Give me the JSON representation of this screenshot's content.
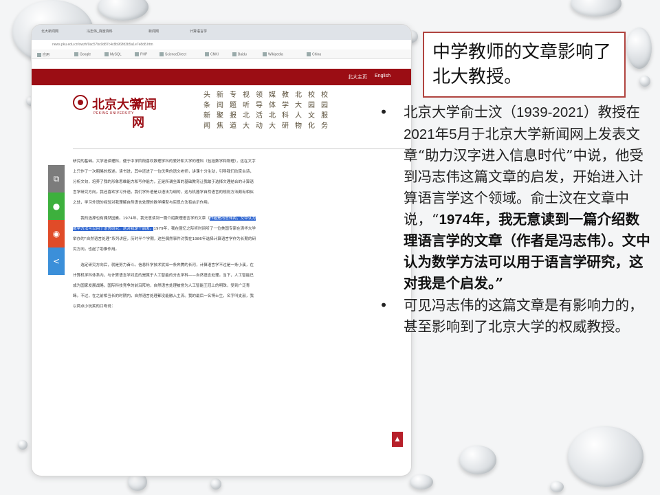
{
  "slide": {
    "title": "中学教师的文章影响了北大教授。",
    "bullets": [
      {
        "text_before": "北京大学俞士汶（",
        "years": "1939-2021",
        "text_mid": "）教授在",
        "month": "2021",
        "text_mid2": "年",
        "month_num": "5",
        "text_after": "月于北京大学新闻网上发表文章“助力汉字进入信息时代”中说，他受到冯志伟这篇文章的启发，开始进入计算语言学这个领域。俞士汶在文章中说，“",
        "quote_year": "1974",
        "quote": "年，我无意读到一篇介绍数理语言学的文章（作者是冯志伟）。文中认为数学方法可以用于语言学研究，这对我是个启发。”"
      },
      {
        "text": "可见冯志伟的这篇文章是有影响力的，甚至影响到了北京大学的权威教授。"
      }
    ]
  },
  "screenshot": {
    "tabs": [
      "北大新闻网",
      "冯志伟_百度百科",
      "新闻网",
      "计算语言学"
    ],
    "url": "news.pku.edu.cn/xwzh/0ac57bc0d87c4c8b9f2fd3b5a1e7e8d8.htm",
    "bookmarks": [
      "应用",
      "Google",
      "MySQL",
      "PHP",
      "ScienceDirect",
      "CNKI",
      "Baidu",
      "Wikipedia",
      "China"
    ],
    "redbar_links": "北大主页",
    "redbar_en": "English",
    "logo_cn": "北京大学",
    "logo_news": "新闻网",
    "logo_en": "PEKING UNIVERSITY",
    "nav_columns": [
      "头条新闻",
      "新闻聚焦",
      "专题报道",
      "视听北大",
      "领导活动",
      "媒体北大",
      "教学科研",
      "北大人物",
      "校园文化",
      "校园服务"
    ],
    "article_paragraphs": [
      "研究的基础。大学选读理科，便于中学阶段喜欢数理学科的爱好和大学的理科（包括数学和物理），这在文字上只作了一次粗略的叙述。读书进，其中还进了一位优秀的语文老师，讲课十分生动，引导我们欣赏古诗，分析文句，培养了我的形象思维能力和写作能力，正是所谓全面的基础教育让我敢于选择文理结合的计算语言学研究方向。我还喜欢学习外语，我们学外语是以语法为纲的，这与机器学自然语言的规则方法颇有相似之处，学习外语的经验对我理解自然语言处理的数学模型与实现方法有启示作用。",
      "我的选择也有偶然因素。1974年，我无意读到一篇介绍数理语言学的文章（作者是冯志伟）。文中认为数学方法可以用于语言学研究，这对我是个启发。1979年，我在暨忆之际听时间听了一位美国专家在清华大学举办的“自然语言处理”系列讲座，历时半个学期，这些偶然事件对我在1986年选择计算语言学作为长期的研究方向，也起了助推作用。",
      "选定研究方向后，就是努力奋斗。信息科学技术犹如一条奔腾的长河，计算语言学不过是一条小溪，在计算机学科体系内，与计算语言学对应的是属于人工智能的分支学科——自然语言处理。当下，人工智能已成为国家发展战略，国际科技竞争的前沿阵地，自然语言处理被誉为人工智能王冠上的明珠，受到广泛青睐。不过，在之前相当长的时期内，自然语言处理都没能融入主流。我的最后一名博士生，名字叫支淑，我以两点小玩笑的口吻说："
    ],
    "highlight_start": "作者是冯志伟",
    "highlight_line2": "两，文中认为数学方法可以用于语言研究，这对我是个启发。"
  },
  "colors": {
    "brand_red": "#9b0d14",
    "title_border": "#b0433f",
    "highlight": "#2f66d1"
  }
}
